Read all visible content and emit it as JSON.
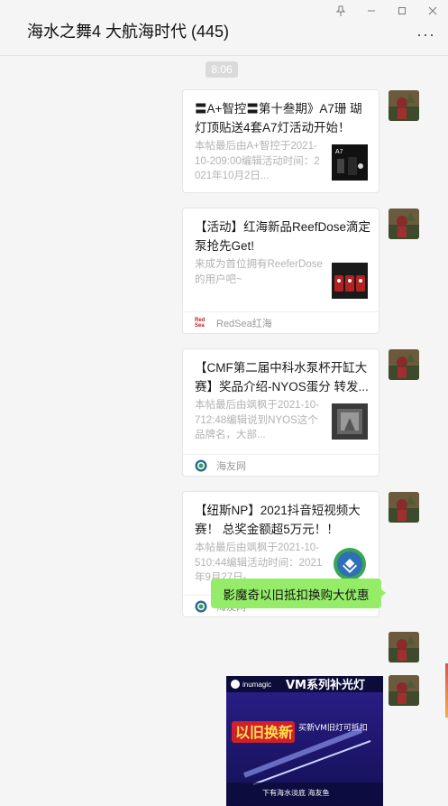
{
  "window": {
    "controls": [
      "pin-icon",
      "minimize-icon",
      "maximize-icon",
      "close-icon"
    ],
    "title": "海水之舞4 大航海时代 (445)",
    "more": "···"
  },
  "chat": {
    "time": "8:06",
    "messages": [
      {
        "type": "link-card",
        "title": "〓A+智控〓第十叁期》A7珊 瑚灯顶贴送4套A7灯活动开始！",
        "desc": "本帖最后由A+智控于2021-10-209:00编辑活动时间：2021年10月2日...",
        "source": ""
      },
      {
        "type": "link-card",
        "title": "【活动】红海新品ReefDose滴定泵抢先Get!",
        "desc": "来成为首位拥有ReeferDose的用户吧~",
        "source": "RedSea红海",
        "source_logo": "Red Sea"
      },
      {
        "type": "link-card",
        "title": "【CMF第二届中科水泵杯开缸大赛】奖品介绍-NYOS蛋分 转发...",
        "desc": "本帖最后由飒枫于2021-10-712:48编辑说到NYOS这个品牌名，大部...",
        "source": "海友网"
      },
      {
        "type": "link-card",
        "title": "【纽斯NP】2021抖音短视频大赛！ 总奖金额超5万元！！",
        "desc": "本帖最后由飒枫于2021-10-510:44编辑活动时间：2021年9月27日-...",
        "source": "海友网"
      },
      {
        "type": "text",
        "text": "影魔奇以旧抵扣换购大优惠"
      },
      {
        "type": "image",
        "brand": "inumagic",
        "headline": "VM系列补光灯",
        "badge": "以旧换新",
        "subline": "买新VM旧灯可抵扣",
        "footer": "下有海水淡底 海友鱼"
      }
    ]
  },
  "colors": {
    "accent_green": "#95ec69",
    "background": "#f5f5f5",
    "card": "#ffffff",
    "muted_text": "#b3b3b3"
  }
}
